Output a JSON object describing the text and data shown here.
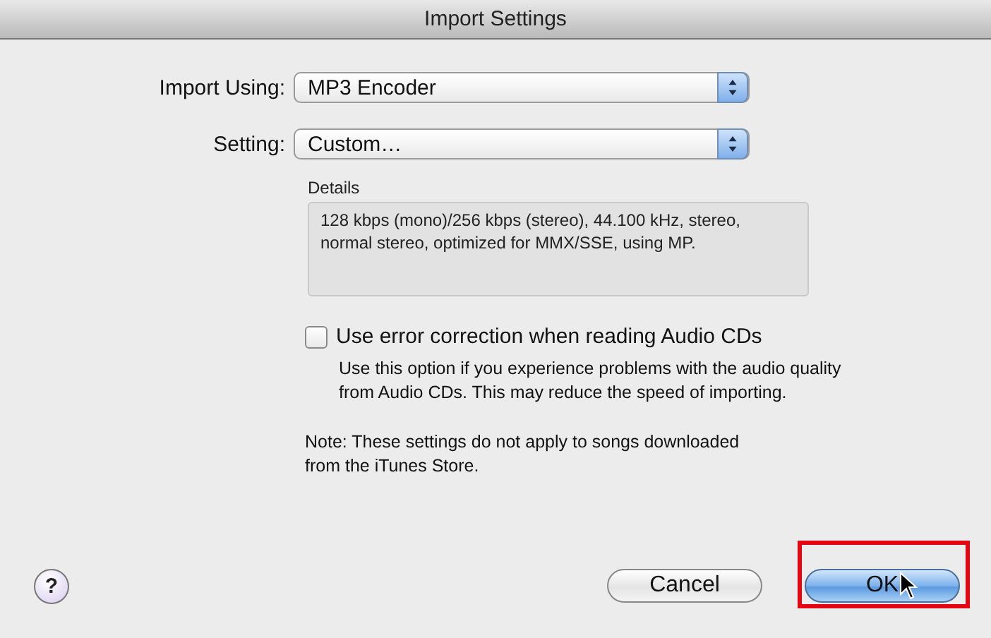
{
  "window": {
    "title": "Import Settings"
  },
  "fields": [
    {
      "label": "Import Using:",
      "value": "MP3 Encoder"
    },
    {
      "label": "Setting:",
      "value": "Custom…"
    }
  ],
  "details": {
    "label": "Details",
    "text": "128 kbps (mono)/256 kbps (stereo), 44.100 kHz, stereo, normal stereo, optimized for MMX/SSE, using MP."
  },
  "option": {
    "label": "Use error correction when reading Audio CDs",
    "checked": false,
    "description": "Use this option if you experience problems with the audio quality from Audio CDs.  This may reduce the speed of importing."
  },
  "note": "Note: These settings do not apply to songs downloaded from the iTunes Store.",
  "help": {
    "label": "?"
  },
  "buttons": [
    {
      "label": "Cancel",
      "default": false,
      "highlighted": false
    },
    {
      "label": "OK",
      "default": true,
      "highlighted": true
    }
  ]
}
